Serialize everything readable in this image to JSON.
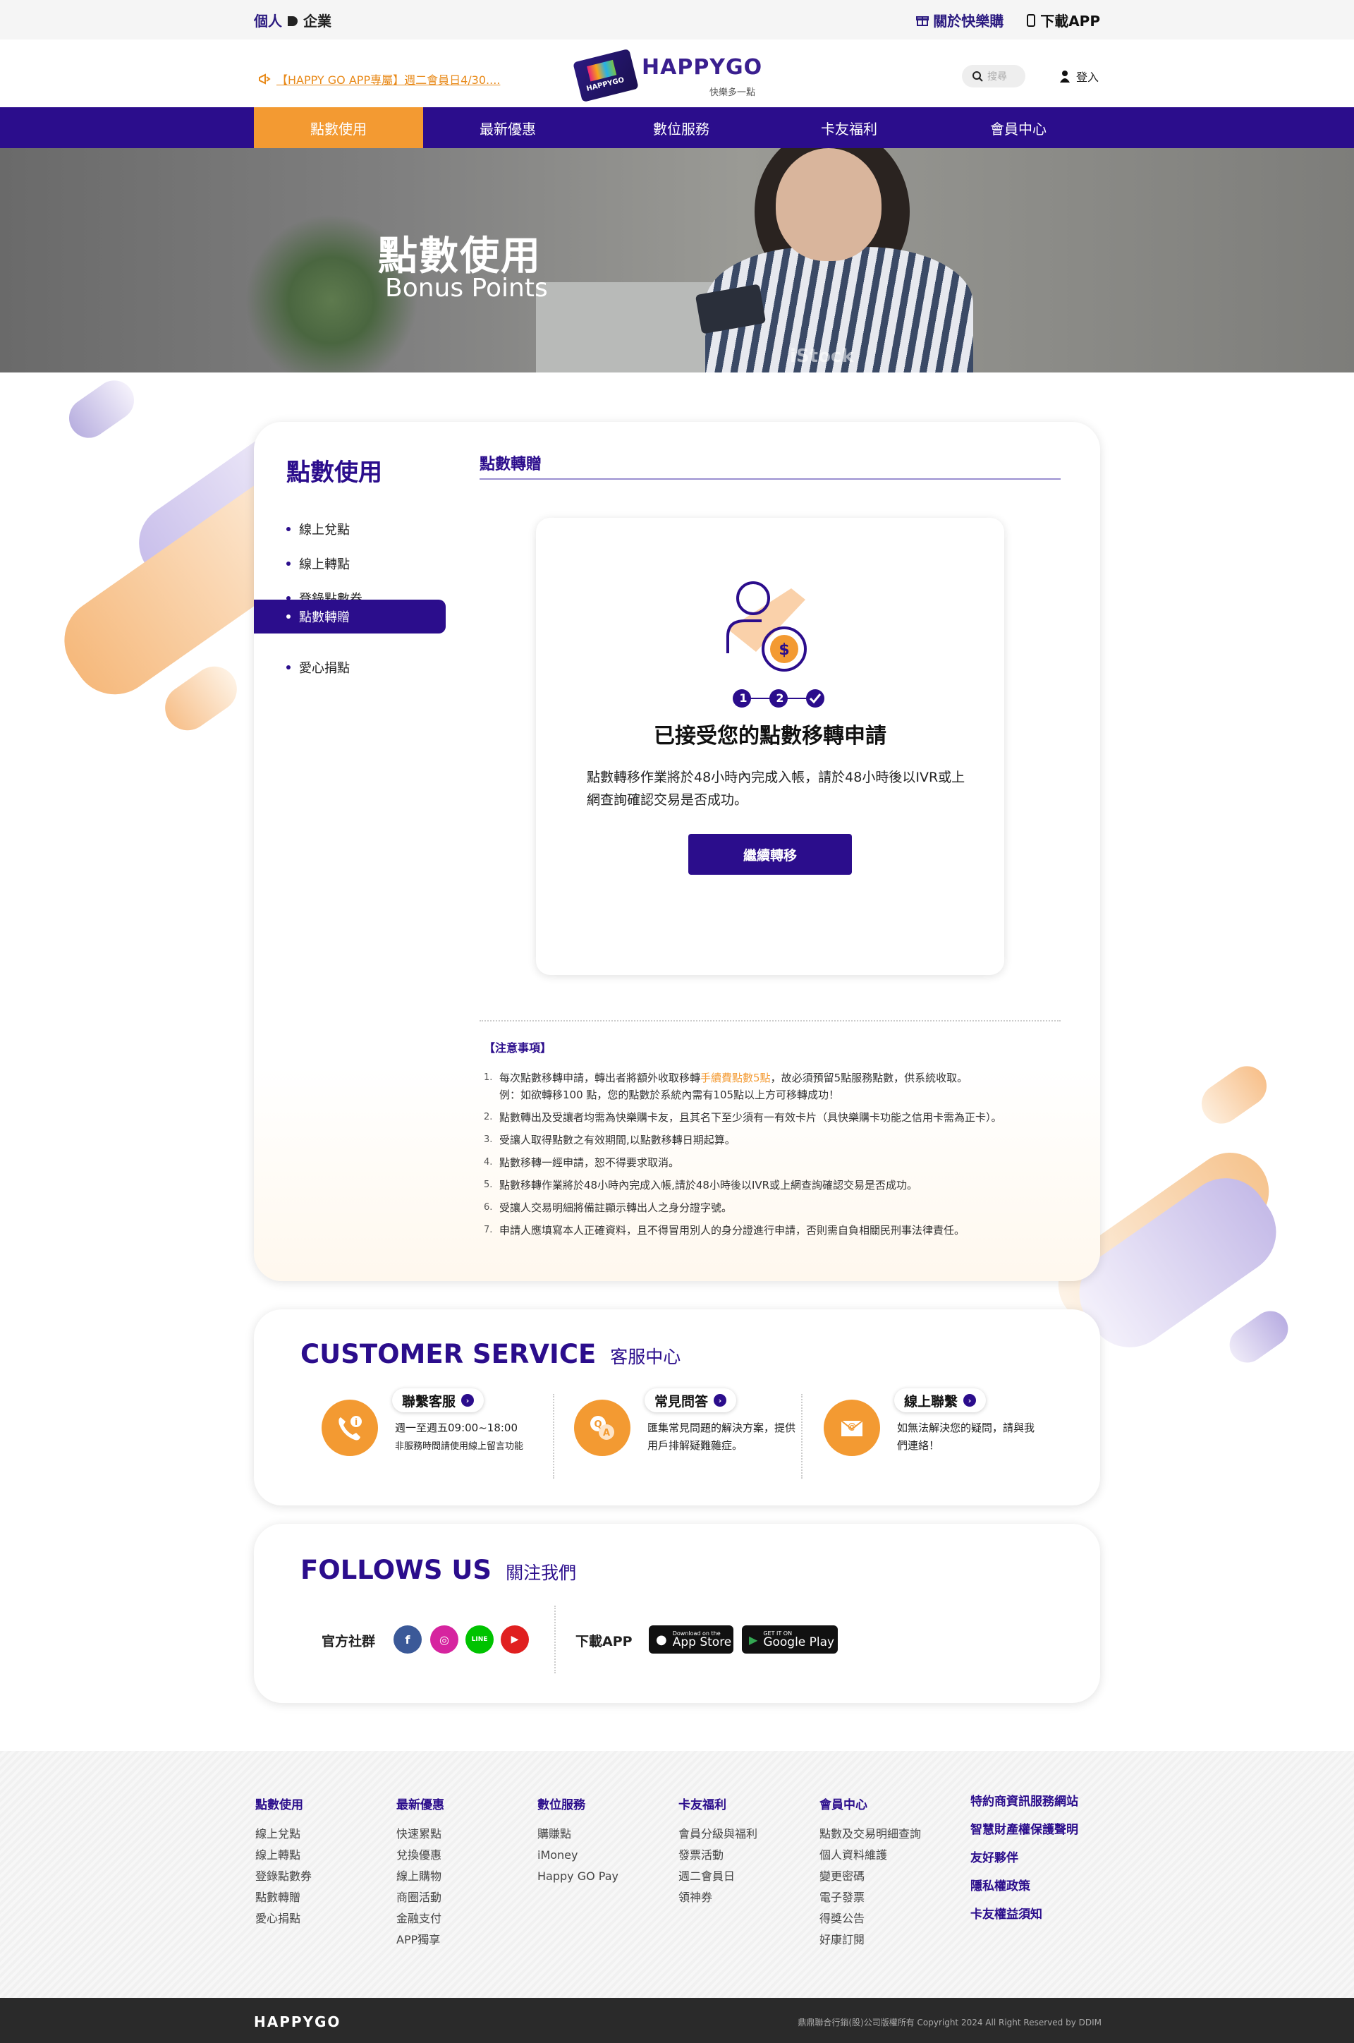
{
  "topbar": {
    "personal": "個人",
    "business": "企業",
    "about": "關於快樂購",
    "download": "下載APP"
  },
  "header": {
    "marquee": "【HAPPY GO APP專屬】週二會員日4/30....",
    "logo_text": "HAPPYGO",
    "logo_slogan": "快樂多一點",
    "card_text": "HAPPYGO",
    "search_placeholder": "搜尋",
    "login": "登入"
  },
  "nav": [
    {
      "label": "點數使用",
      "active": true
    },
    {
      "label": "最新優惠"
    },
    {
      "label": "數位服務"
    },
    {
      "label": "卡友福利"
    },
    {
      "label": "會員中心"
    }
  ],
  "hero": {
    "title": "點數使用",
    "subtitle": "Bonus Points",
    "watermark": "iStock"
  },
  "sidebar": {
    "title": "點數使用",
    "items": [
      {
        "label": "線上兌點"
      },
      {
        "label": "線上轉點"
      },
      {
        "label": "登錄點數券"
      },
      {
        "label": "點數轉贈",
        "active": true
      },
      {
        "label": "愛心捐點"
      }
    ]
  },
  "section": {
    "title": "點數轉贈"
  },
  "result": {
    "steps": [
      "1",
      "2"
    ],
    "title": "已接受您的點數移轉申請",
    "text": "點數轉移作業將於48小時內完成入帳，請於48小時後以IVR或上網查詢確認交易是否成功。",
    "button": "繼續轉移"
  },
  "notes": {
    "title": "【注意事項】",
    "items": [
      {
        "n": "1.",
        "pre": "每次點數移轉申請，轉出者將額外收取移轉",
        "highlight": "手續費點數5點",
        "post": "，故必須預留5點服務點數，供系統收取。",
        "sub": "例：如欲轉移100 點，您的點數於系統內需有105點以上方可移轉成功！"
      },
      {
        "n": "2.",
        "text": "點數轉出及受讓者均需為快樂購卡友，且其名下至少須有一有效卡片（具快樂購卡功能之信用卡需為正卡）。"
      },
      {
        "n": "3.",
        "text": "受讓人取得點數之有效期間,以點數移轉日期起算。"
      },
      {
        "n": "4.",
        "text": "點數移轉一經申請，恕不得要求取消。"
      },
      {
        "n": "5.",
        "text": "點數移轉作業將於48小時內完成入帳,請於48小時後以IVR或上網查詢確認交易是否成功。"
      },
      {
        "n": "6.",
        "text": "受讓人交易明細將備註顯示轉出人之身分證字號。"
      },
      {
        "n": "7.",
        "text": "申請人應填寫本人正確資料，且不得冒用別人的身分證進行申請，否則需自負相關民刑事法律責任。"
      }
    ]
  },
  "customer_service": {
    "title": "CUSTOMER SERVICE",
    "title_zh": "客服中心",
    "items": [
      {
        "label": "聯繫客服",
        "desc": "週一至週五09:00~18:00",
        "small": "非服務時間請使用線上留言功能",
        "icon": "phone-info-icon"
      },
      {
        "label": "常見問答",
        "desc": "匯集常見問題的解決方案，提供用戶排解疑難雜症。",
        "icon": "faq-icon"
      },
      {
        "label": "線上聯繫",
        "desc": "如無法解決您的疑問，請與我們連絡！",
        "icon": "mail-icon"
      }
    ]
  },
  "follows": {
    "title": "FOLLOWS US",
    "title_zh": "關注我們",
    "social_label": "官方社群",
    "download_label": "下載APP",
    "social": [
      {
        "name": "facebook-icon",
        "glyph": "f",
        "color": "#3b5998"
      },
      {
        "name": "instagram-icon",
        "glyph": "◎",
        "color": "#d6249f"
      },
      {
        "name": "line-icon",
        "glyph": "LINE",
        "color": "#00c300"
      },
      {
        "name": "youtube-icon",
        "glyph": "▶",
        "color": "#e02020"
      }
    ],
    "appstore": {
      "small": "Download on the",
      "big": "App Store"
    },
    "googleplay": {
      "small": "GET IT ON",
      "big": "Google Play"
    }
  },
  "footer": {
    "columns": [
      {
        "title": "點數使用",
        "items": [
          "線上兌點",
          "線上轉點",
          "登錄點數券",
          "點數轉贈",
          "愛心捐點"
        ]
      },
      {
        "title": "最新優惠",
        "items": [
          "快速累點",
          "兌換優惠",
          "線上購物",
          "商圈活動",
          "金融支付",
          "APP獨享"
        ]
      },
      {
        "title": "數位服務",
        "items": [
          "購賺點",
          "iMoney",
          "Happy GO Pay"
        ]
      },
      {
        "title": "卡友福利",
        "items": [
          "會員分級與福利",
          "發票活動",
          "週二會員日",
          "領神券"
        ]
      },
      {
        "title": "會員中心",
        "items": [
          "點數及交易明細查詢",
          "個人資料維護",
          "變更密碼",
          "電子發票",
          "得獎公告",
          "好康訂閱"
        ]
      }
    ],
    "links": [
      "特約商資訊服務網站",
      "智慧財產權保護聲明",
      "友好夥伴",
      "隱私權政策",
      "卡友權益須知"
    ],
    "brand": "HAPPYGO",
    "copyright": "鼎鼎聯合行銷(股)公司版權所有 Copyright 2024 All Right Reserved by DDIM"
  },
  "colors": {
    "primary": "#2b0d8c",
    "accent": "#f39a32"
  }
}
